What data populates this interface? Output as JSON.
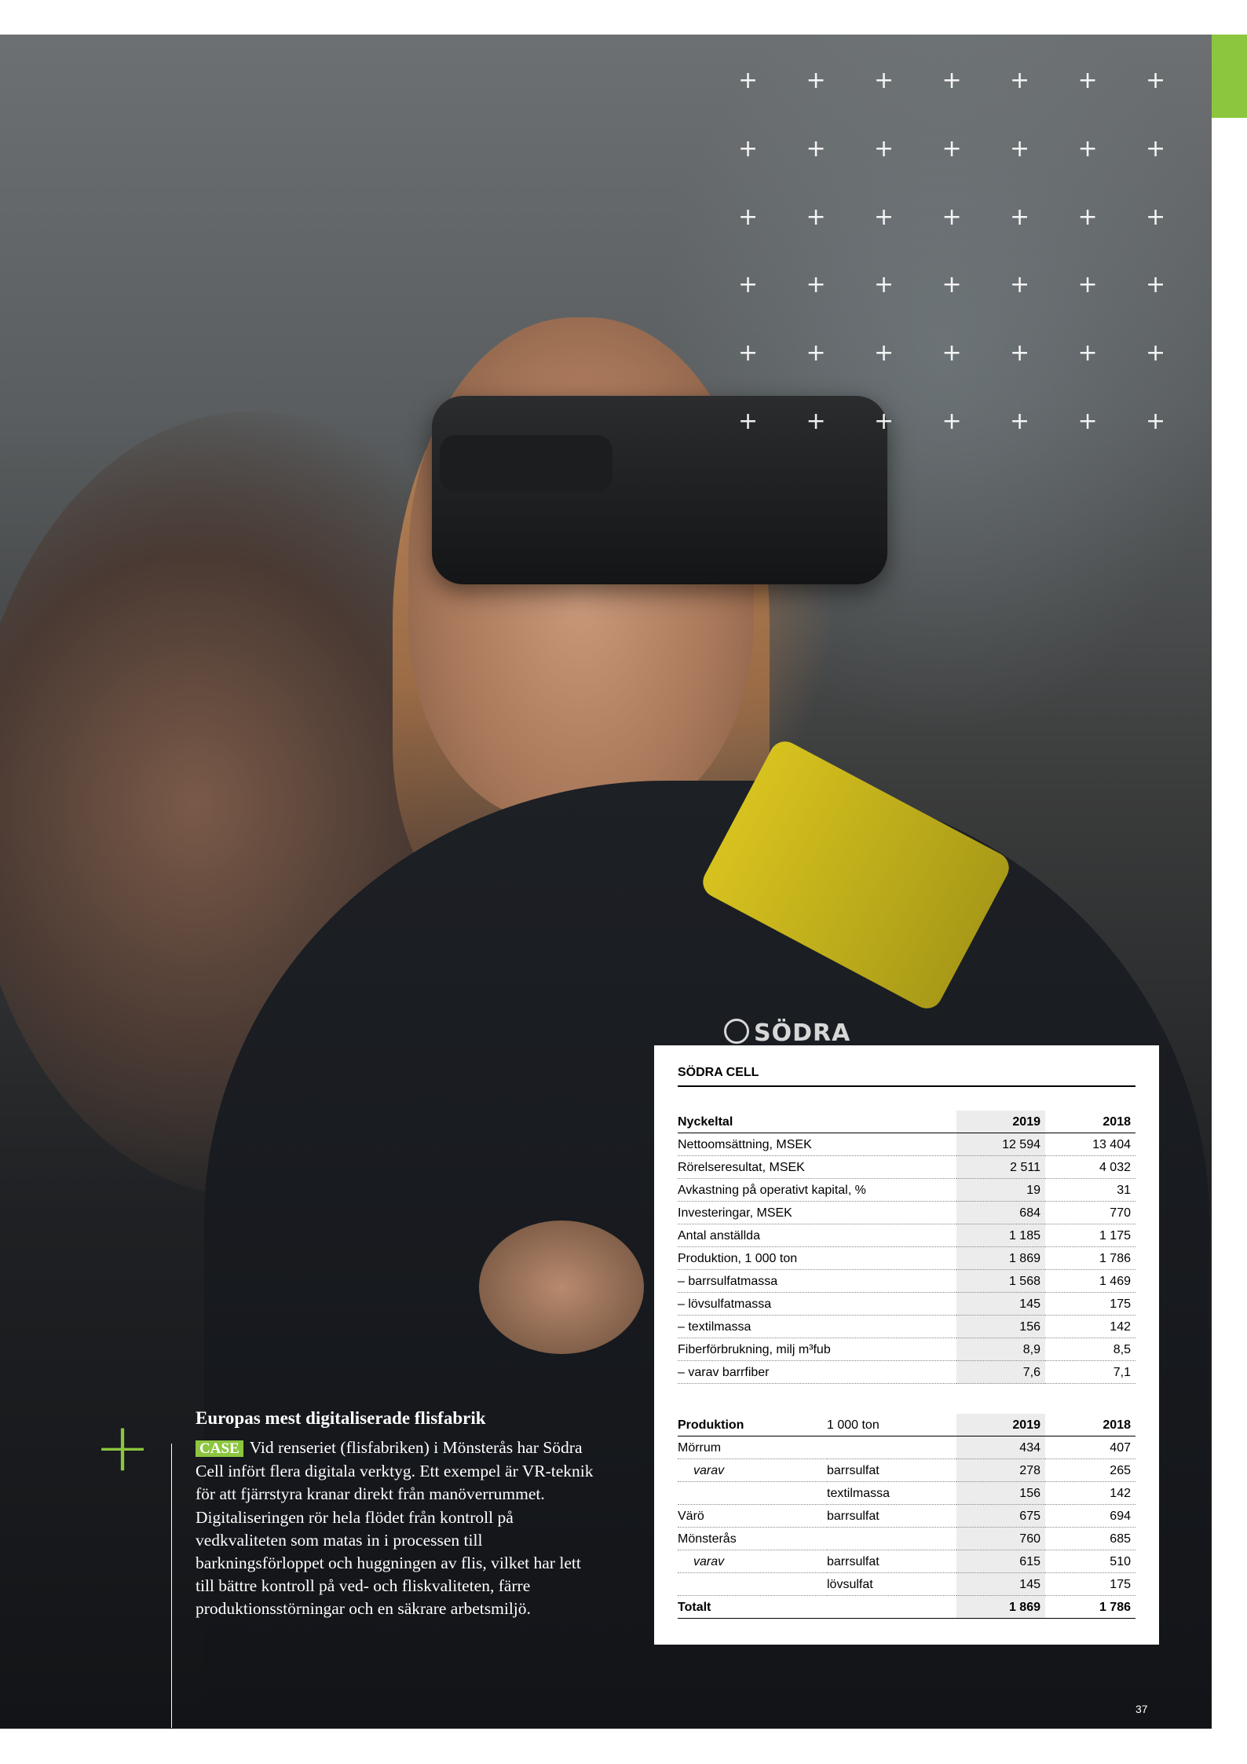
{
  "photo": {
    "brand_text": "SÖDRA",
    "cross_glyph": "+"
  },
  "case": {
    "title": "Europas mest digitaliserade flisfabrik",
    "tag": "CASE",
    "body": "Vid renseriet (flisfabriken) i Mönsterås har Södra Cell infört flera digitala verktyg. Ett exempel är VR-teknik för att fjärrstyra kranar direkt från manöverrummet. Digitaliseringen rör hela flödet från kontroll på vedkvaliteten som matas in i processen till barkningsförloppet och huggningen av flis, vilket har lett till bättre kontroll på ved- och fliskvaliteten, färre produktionsstörningar och en säkrare arbetsmiljö."
  },
  "panel": {
    "title": "SÖDRA CELL",
    "kpi": {
      "headers": [
        "Nyckeltal",
        "2019",
        "2018"
      ],
      "rows": [
        [
          "Nettoomsättning, MSEK",
          "12 594",
          "13 404"
        ],
        [
          "Rörelseresultat, MSEK",
          "2 511",
          "4 032"
        ],
        [
          "Avkastning på operativt kapital, %",
          "19",
          "31"
        ],
        [
          "Investeringar, MSEK",
          "684",
          "770"
        ],
        [
          "Antal anställda",
          "1 185",
          "1 175"
        ],
        [
          "Produktion, 1 000 ton",
          "1 869",
          "1 786"
        ],
        [
          "– barrsulfatmassa",
          "1 568",
          "1 469"
        ],
        [
          "– lövsulfatmassa",
          "145",
          "175"
        ],
        [
          "– textilmassa",
          "156",
          "142"
        ],
        [
          "Fiberförbrukning, milj m³fub",
          "8,9",
          "8,5"
        ],
        [
          "– varav barrfiber",
          "7,6",
          "7,1"
        ]
      ]
    },
    "production": {
      "headers": [
        "Produktion",
        "1 000 ton",
        "2019",
        "2018"
      ],
      "rows": [
        [
          "Mörrum",
          "",
          "434",
          "407"
        ],
        [
          "varav",
          "barrsulfat",
          "278",
          "265"
        ],
        [
          "",
          "textilmassa",
          "156",
          "142"
        ],
        [
          "Värö",
          "barrsulfat",
          "675",
          "694"
        ],
        [
          "Mönsterås",
          "",
          "760",
          "685"
        ],
        [
          "varav",
          "barrsulfat",
          "615",
          "510"
        ],
        [
          "",
          "lövsulfat",
          "145",
          "175"
        ]
      ],
      "total": [
        "Totalt",
        "",
        "1 869",
        "1 786"
      ]
    }
  },
  "page_number": "37",
  "colors": {
    "accent_green": "#8cc63f",
    "table_shade": "#ececec"
  }
}
